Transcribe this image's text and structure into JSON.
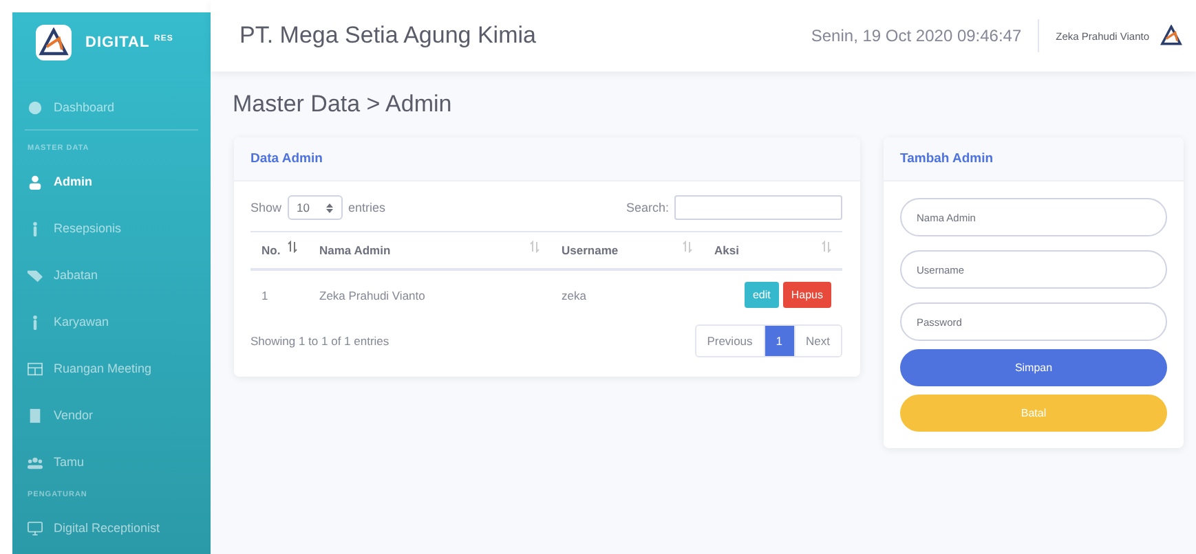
{
  "sidebar": {
    "brand": {
      "name": "DIGITAL",
      "sup": "RES"
    },
    "items": [
      {
        "kind": "link",
        "label": "Dashboard",
        "selected": false
      },
      {
        "kind": "divider"
      },
      {
        "kind": "heading",
        "label": "MASTER DATA"
      },
      {
        "kind": "link",
        "label": "Admin",
        "selected": true
      },
      {
        "kind": "link",
        "label": "Resepsionis",
        "selected": false
      },
      {
        "kind": "link",
        "label": "Jabatan",
        "selected": false
      },
      {
        "kind": "link",
        "label": "Karyawan",
        "selected": false
      },
      {
        "kind": "link",
        "label": "Ruangan Meeting",
        "selected": false
      },
      {
        "kind": "link",
        "label": "Vendor",
        "selected": false
      },
      {
        "kind": "link",
        "label": "Tamu",
        "selected": false
      },
      {
        "kind": "heading",
        "label": "PENGATURAN"
      },
      {
        "kind": "link",
        "label": "Digital Receptionist",
        "selected": false
      }
    ]
  },
  "topbar": {
    "company": "PT. Mega Setia Agung Kimia",
    "datetime": "Senin, 19 Oct 2020 09:46:47",
    "user": "Zeka Prahudi Vianto"
  },
  "page_title": "Master Data > Admin",
  "table_card": {
    "title": "Data Admin",
    "show_label": "Show",
    "page_size": "10",
    "entries_label": "entries",
    "search_label": "Search:",
    "columns": [
      "No.",
      "Nama Admin",
      "Username",
      "Aksi"
    ],
    "rows": [
      {
        "no": "1",
        "name": "Zeka Prahudi Vianto",
        "username": "zeka",
        "actions": [
          "edit",
          "Hapus"
        ]
      }
    ],
    "info": "Showing 1 to 1 of 1 entries",
    "pagination": [
      {
        "label": "Previous",
        "selected": false
      },
      {
        "label": "1",
        "selected": true
      },
      {
        "label": "Next",
        "selected": false
      }
    ]
  },
  "form_card": {
    "title": "Tambah Admin",
    "fields": [
      {
        "placeholder": "Nama Admin"
      },
      {
        "placeholder": "Username"
      },
      {
        "placeholder": "Password"
      }
    ],
    "buttons": [
      "Simpan",
      "Batal"
    ]
  }
}
